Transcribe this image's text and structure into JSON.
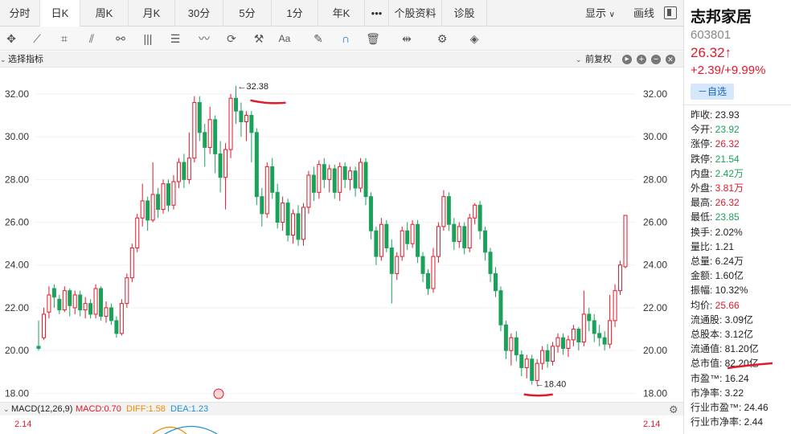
{
  "tabs": [
    {
      "label": "分时",
      "w": 50
    },
    {
      "label": "日K",
      "w": 50,
      "active": true
    },
    {
      "label": "周K",
      "w": 60
    },
    {
      "label": "月K",
      "w": 58
    },
    {
      "label": "30分",
      "w": 60
    },
    {
      "label": "5分",
      "w": 60
    },
    {
      "label": "1分",
      "w": 58
    },
    {
      "label": "年K",
      "w": 58
    }
  ],
  "more_label": "•••",
  "tabs_right": [
    {
      "label": "个股资料",
      "w": 66
    },
    {
      "label": "诊股",
      "w": 56
    }
  ],
  "display_label": "显示",
  "draw_label": "画线",
  "indicator_select": "选择指标",
  "adjust_label": "前复权",
  "macd": {
    "title": "MACD(12,26,9)",
    "macd": "MACD:0.70",
    "diff": "DIFF:1.58",
    "dea": "DEA:1.23",
    "axis": "2.14"
  },
  "chart_data": {
    "type": "candlestick",
    "yticks": [
      "32.00",
      "30.00",
      "28.00",
      "26.00",
      "24.00",
      "22.00",
      "20.00",
      "18.00"
    ],
    "ylim": [
      17.6,
      33.2
    ],
    "high_annotation": "←32.38",
    "low_annotation": "←18.40",
    "candles": [
      [
        20.2,
        20.1,
        21.4,
        20.0
      ],
      [
        20.6,
        21.7,
        22.0,
        20.5
      ],
      [
        21.8,
        22.6,
        23.0,
        21.5
      ],
      [
        22.9,
        22.5,
        23.1,
        22.0
      ],
      [
        22.4,
        21.9,
        22.6,
        21.7
      ],
      [
        21.9,
        22.8,
        23.0,
        21.8
      ],
      [
        22.8,
        22.1,
        22.9,
        21.6
      ],
      [
        22.0,
        22.6,
        22.8,
        21.7
      ],
      [
        22.6,
        21.9,
        22.8,
        21.6
      ],
      [
        21.9,
        22.2,
        22.5,
        21.5
      ],
      [
        22.2,
        21.7,
        22.4,
        21.5
      ],
      [
        21.7,
        22.9,
        23.1,
        21.5
      ],
      [
        22.9,
        21.6,
        23.0,
        21.4
      ],
      [
        21.6,
        22.0,
        22.3,
        21.3
      ],
      [
        22.0,
        21.4,
        22.2,
        21.2
      ],
      [
        21.4,
        20.8,
        21.6,
        20.6
      ],
      [
        20.8,
        22.2,
        22.4,
        20.7
      ],
      [
        22.2,
        23.4,
        23.6,
        22.0
      ],
      [
        23.4,
        24.8,
        25.0,
        23.2
      ],
      [
        24.8,
        26.2,
        26.4,
        24.6
      ],
      [
        26.2,
        27.0,
        27.8,
        25.8
      ],
      [
        27.0,
        26.1,
        27.2,
        25.6
      ],
      [
        26.1,
        27.3,
        28.8,
        26.0
      ],
      [
        27.3,
        26.6,
        27.6,
        26.2
      ],
      [
        26.6,
        27.8,
        28.0,
        26.4
      ],
      [
        27.8,
        26.8,
        28.0,
        26.5
      ],
      [
        26.8,
        27.9,
        28.2,
        26.6
      ],
      [
        27.9,
        28.8,
        29.0,
        27.6
      ],
      [
        28.8,
        28.0,
        29.2,
        27.6
      ],
      [
        28.0,
        29.0,
        30.2,
        27.8
      ],
      [
        29.0,
        31.6,
        31.9,
        28.8
      ],
      [
        31.6,
        30.2,
        31.9,
        29.8
      ],
      [
        30.2,
        29.5,
        30.6,
        28.6
      ],
      [
        29.5,
        30.8,
        31.4,
        29.2
      ],
      [
        30.8,
        29.2,
        31.0,
        28.3
      ],
      [
        29.2,
        28.1,
        29.8,
        27.4
      ],
      [
        28.1,
        29.4,
        29.7,
        26.6
      ],
      [
        29.4,
        31.8,
        32.0,
        29.0
      ],
      [
        31.8,
        31.2,
        32.38,
        30.6
      ],
      [
        31.2,
        30.7,
        31.6,
        30.0
      ],
      [
        30.7,
        31.0,
        31.2,
        29.8
      ],
      [
        31.0,
        30.2,
        31.2,
        28.8
      ],
      [
        30.2,
        27.2,
        30.4,
        26.8
      ],
      [
        27.2,
        26.4,
        27.6,
        25.8
      ],
      [
        26.4,
        28.6,
        28.8,
        26.2
      ],
      [
        28.6,
        27.4,
        29.0,
        27.1
      ],
      [
        27.4,
        26.0,
        27.8,
        25.7
      ],
      [
        26.0,
        26.9,
        27.2,
        25.6
      ],
      [
        26.9,
        25.4,
        27.1,
        25.1
      ],
      [
        25.4,
        26.4,
        26.6,
        25.0
      ],
      [
        26.4,
        25.2,
        26.8,
        24.9
      ],
      [
        25.2,
        26.7,
        26.9,
        24.9
      ],
      [
        26.7,
        28.2,
        28.4,
        26.4
      ],
      [
        28.2,
        27.4,
        28.6,
        27.0
      ],
      [
        27.4,
        28.7,
        28.9,
        27.1
      ],
      [
        28.7,
        28.0,
        29.0,
        27.6
      ],
      [
        28.0,
        28.5,
        28.7,
        27.4
      ],
      [
        28.5,
        27.4,
        28.7,
        27.1
      ],
      [
        27.4,
        28.6,
        28.8,
        27.0
      ],
      [
        28.6,
        28.0,
        28.8,
        27.6
      ],
      [
        28.0,
        28.4,
        28.6,
        27.5
      ],
      [
        28.4,
        27.6,
        28.6,
        27.2
      ],
      [
        27.6,
        28.8,
        29.0,
        27.4
      ],
      [
        28.8,
        27.2,
        29.0,
        26.8
      ],
      [
        27.2,
        25.6,
        27.4,
        25.2
      ],
      [
        25.6,
        24.4,
        25.8,
        24.0
      ],
      [
        24.4,
        25.9,
        26.2,
        24.2
      ],
      [
        25.9,
        24.8,
        26.1,
        24.6
      ],
      [
        24.8,
        23.6,
        25.2,
        22.2
      ],
      [
        23.6,
        24.4,
        24.6,
        23.3
      ],
      [
        24.4,
        25.6,
        25.8,
        24.2
      ],
      [
        25.6,
        25.0,
        26.0,
        24.7
      ],
      [
        25.0,
        25.9,
        26.1,
        24.8
      ],
      [
        25.9,
        24.4,
        26.1,
        24.1
      ],
      [
        24.4,
        23.6,
        24.6,
        23.2
      ],
      [
        23.6,
        22.9,
        23.8,
        22.6
      ],
      [
        22.9,
        24.4,
        24.8,
        22.7
      ],
      [
        24.4,
        25.8,
        26.0,
        24.1
      ],
      [
        25.8,
        27.2,
        27.5,
        25.6
      ],
      [
        27.2,
        25.9,
        27.4,
        25.6
      ],
      [
        25.9,
        25.1,
        26.2,
        24.7
      ],
      [
        25.1,
        25.8,
        26.0,
        24.8
      ],
      [
        25.8,
        24.8,
        26.0,
        24.5
      ],
      [
        24.8,
        26.2,
        26.4,
        24.6
      ],
      [
        26.2,
        26.8,
        26.9,
        25.9
      ],
      [
        26.8,
        25.6,
        27.0,
        25.2
      ],
      [
        25.6,
        24.6,
        25.8,
        24.2
      ],
      [
        24.6,
        23.6,
        24.8,
        23.2
      ],
      [
        23.6,
        22.8,
        23.9,
        22.5
      ],
      [
        22.8,
        21.2,
        23.0,
        20.9
      ],
      [
        21.2,
        20.0,
        21.4,
        19.6
      ],
      [
        20.0,
        20.6,
        20.8,
        19.3
      ],
      [
        20.6,
        19.8,
        20.9,
        19.5
      ],
      [
        19.8,
        19.2,
        20.0,
        18.8
      ],
      [
        19.2,
        19.6,
        19.8,
        18.7
      ],
      [
        19.6,
        18.6,
        19.8,
        18.4
      ],
      [
        18.6,
        19.4,
        19.6,
        18.4
      ],
      [
        19.4,
        20.0,
        20.2,
        19.1
      ],
      [
        20.0,
        19.5,
        20.3,
        19.2
      ],
      [
        19.5,
        20.2,
        20.4,
        19.3
      ],
      [
        20.2,
        20.6,
        20.8,
        19.9
      ],
      [
        20.6,
        20.1,
        20.8,
        19.8
      ],
      [
        20.1,
        20.5,
        20.7,
        19.7
      ],
      [
        20.5,
        21.0,
        21.2,
        20.2
      ],
      [
        21.0,
        20.4,
        21.1,
        20.0
      ],
      [
        20.4,
        21.7,
        22.8,
        20.2
      ],
      [
        21.7,
        21.4,
        22.0,
        20.9
      ],
      [
        21.4,
        20.8,
        21.7,
        20.4
      ],
      [
        20.8,
        20.6,
        21.2,
        20.2
      ],
      [
        20.6,
        20.3,
        20.9,
        20.0
      ],
      [
        20.3,
        21.4,
        22.6,
        20.1
      ],
      [
        21.4,
        22.8,
        23.1,
        21.1
      ],
      [
        22.8,
        24.0,
        24.2,
        22.6
      ],
      [
        23.92,
        26.32,
        26.32,
        23.85
      ]
    ]
  },
  "stock": {
    "name": "志邦家居",
    "code": "603801",
    "price": "26.32↑",
    "change": "+2.39/+9.99%",
    "watch_button": "－自选"
  },
  "quotes": [
    {
      "label": "昨收:",
      "value": "23.93",
      "color": "black"
    },
    {
      "label": "今开:",
      "value": "23.92",
      "color": "green"
    },
    {
      "label": "涨停:",
      "value": "26.32",
      "color": "red"
    },
    {
      "label": "跌停:",
      "value": "21.54",
      "color": "green"
    },
    {
      "label": "内盘:",
      "value": "2.42万",
      "color": "green"
    },
    {
      "label": "外盘:",
      "value": "3.81万",
      "color": "red"
    },
    {
      "label": "最高:",
      "value": "26.32",
      "color": "red"
    },
    {
      "label": "最低:",
      "value": "23.85",
      "color": "green"
    },
    {
      "label": "换手:",
      "value": "2.02%",
      "color": "black"
    },
    {
      "label": "量比:",
      "value": "1.21",
      "color": "black"
    },
    {
      "label": "总量:",
      "value": "6.24万",
      "color": "black"
    },
    {
      "label": "金额:",
      "value": "1.60亿",
      "color": "black"
    },
    {
      "label": "振幅:",
      "value": "10.32%",
      "color": "black"
    },
    {
      "label": "均价:",
      "value": "25.66",
      "color": "red"
    },
    {
      "label": "流通股:",
      "value": "3.09亿",
      "color": "black"
    },
    {
      "label": "总股本:",
      "value": "3.12亿",
      "color": "black"
    },
    {
      "label": "流通值:",
      "value": "81.20亿",
      "color": "black"
    },
    {
      "label": "总市值:",
      "value": "82.20亿",
      "color": "black"
    },
    {
      "label": "市盈™:",
      "value": "16.24",
      "color": "black"
    },
    {
      "label": "市净率:",
      "value": "3.22",
      "color": "black"
    },
    {
      "label": "行业市盈™:",
      "value": "24.46",
      "color": "black"
    },
    {
      "label": "行业市净率:",
      "value": "2.44",
      "color": "black"
    }
  ],
  "colors": {
    "up": "#e0192b",
    "down": "#1aa25a",
    "macd_diff": "#f08a00",
    "macd_dea": "#1f8fd6"
  }
}
